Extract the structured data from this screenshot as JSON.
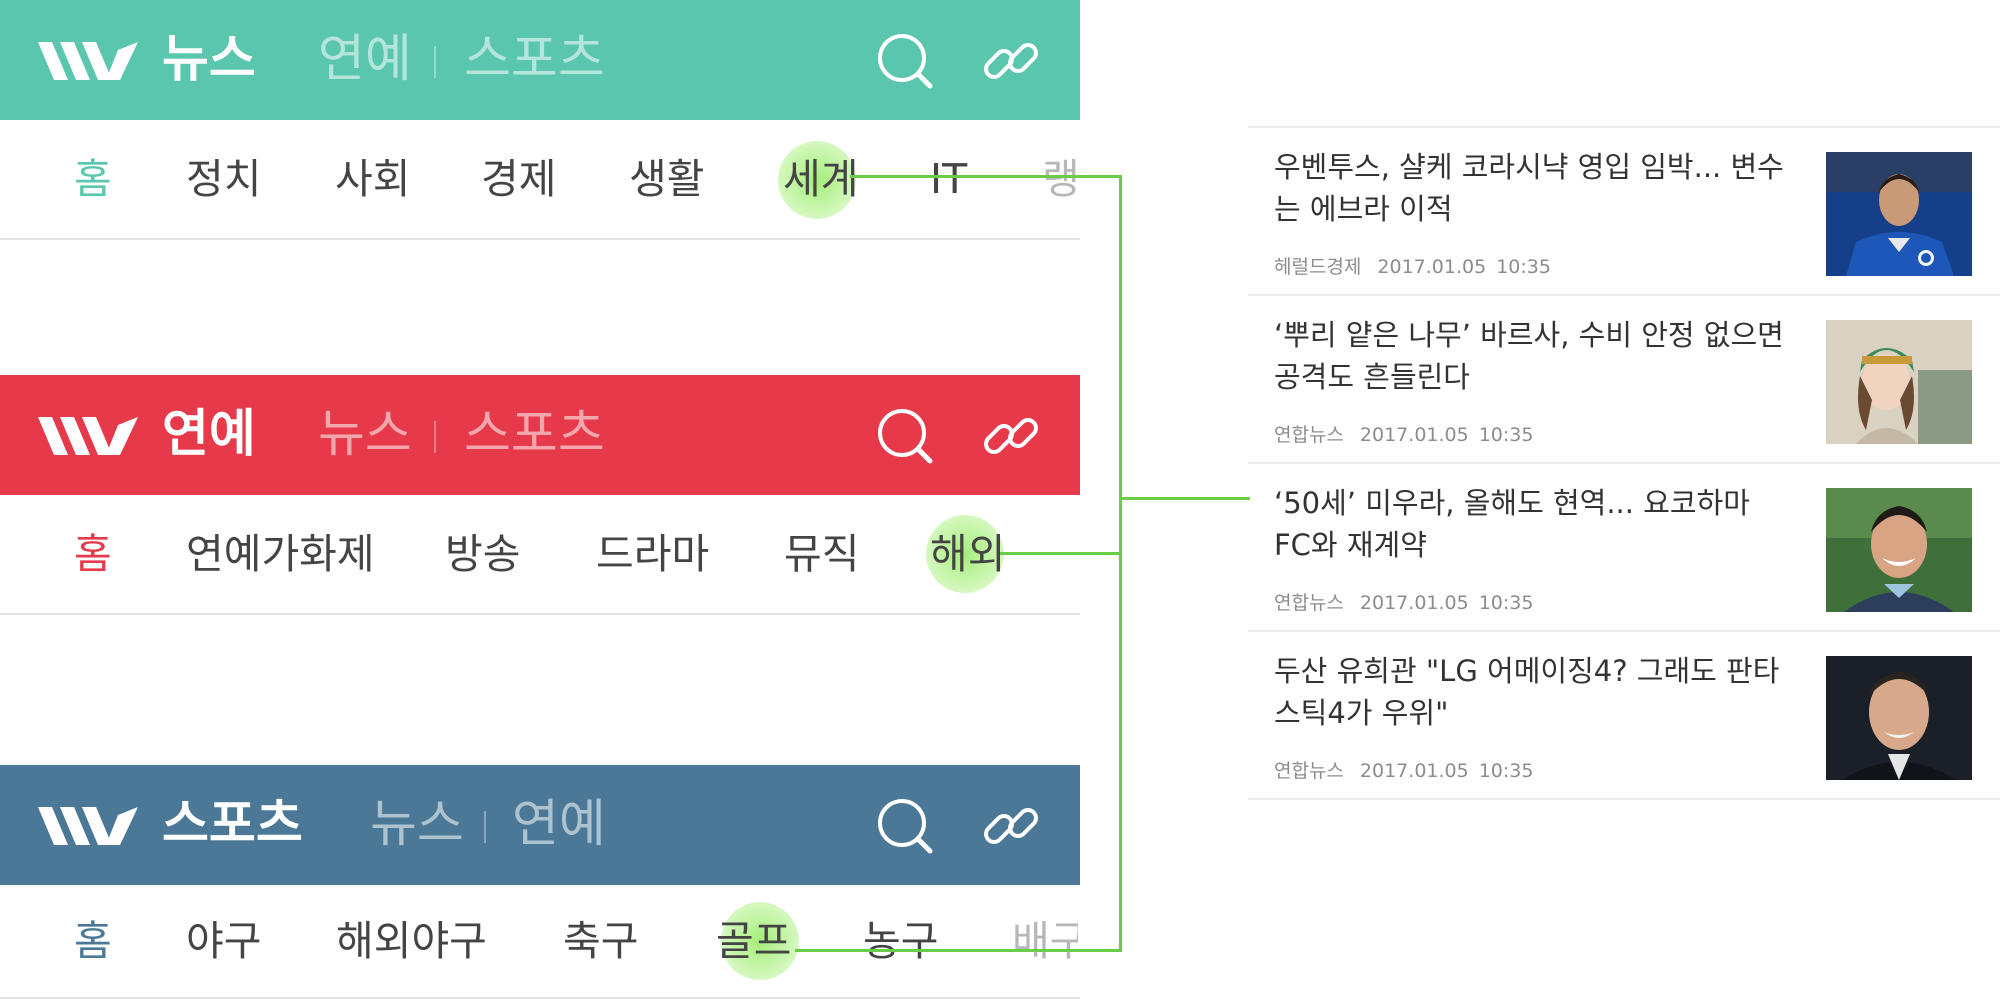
{
  "colors": {
    "news": "#5bc6ae",
    "entertainment": "#e63a4b",
    "sports": "#4a7896",
    "connector": "#6acd48",
    "highlight": "#a6ef78"
  },
  "news_panel": {
    "title": "뉴스",
    "alt_sections": [
      "연예",
      "스포츠"
    ],
    "tabs": [
      "홈",
      "정치",
      "사회",
      "경제",
      "생활",
      "세계",
      "IT",
      "랭"
    ],
    "highlighted_tab": "세계"
  },
  "entertainment_panel": {
    "title": "연예",
    "alt_sections": [
      "뉴스",
      "스포츠"
    ],
    "tabs": [
      "홈",
      "연예가화제",
      "방송",
      "드라마",
      "뮤직",
      "해외"
    ],
    "highlighted_tab": "해외"
  },
  "sports_panel": {
    "title": "스포츠",
    "alt_sections": [
      "뉴스",
      "연예"
    ],
    "tabs": [
      "홈",
      "야구",
      "해외야구",
      "축구",
      "골프",
      "농구",
      "배구"
    ],
    "highlighted_tab": "골프"
  },
  "icons": {
    "search": "search-icon",
    "link": "link-icon",
    "logo": "logo-icon"
  },
  "articles": [
    {
      "title": "우벤투스, 샬케 코라시냑 영입 임박... 변수는 에브라 이적",
      "source": "헤럴드경제",
      "date": "2017.01.05",
      "time": "10:35",
      "thumb": "soccer-player-blue-jersey"
    },
    {
      "title": "‘뿌리 얕은 나무’ 바르사, 수비 안정 없으면 공격도 흔들린다",
      "source": "연합뉴스",
      "date": "2017.01.05",
      "time": "10:35",
      "thumb": "woman-knit-hat"
    },
    {
      "title": "‘50세’ 미우라, 올해도 현역... 요코하마 FC와 재계약",
      "source": "연합뉴스",
      "date": "2017.01.05",
      "time": "10:35",
      "thumb": "smiling-man"
    },
    {
      "title": "두산 유희관 \"LG 어메이징4? 그래도 판타스틱4가 우위\"",
      "source": "연합뉴스",
      "date": "2017.01.05",
      "time": "10:35",
      "thumb": "man-portrait"
    }
  ]
}
